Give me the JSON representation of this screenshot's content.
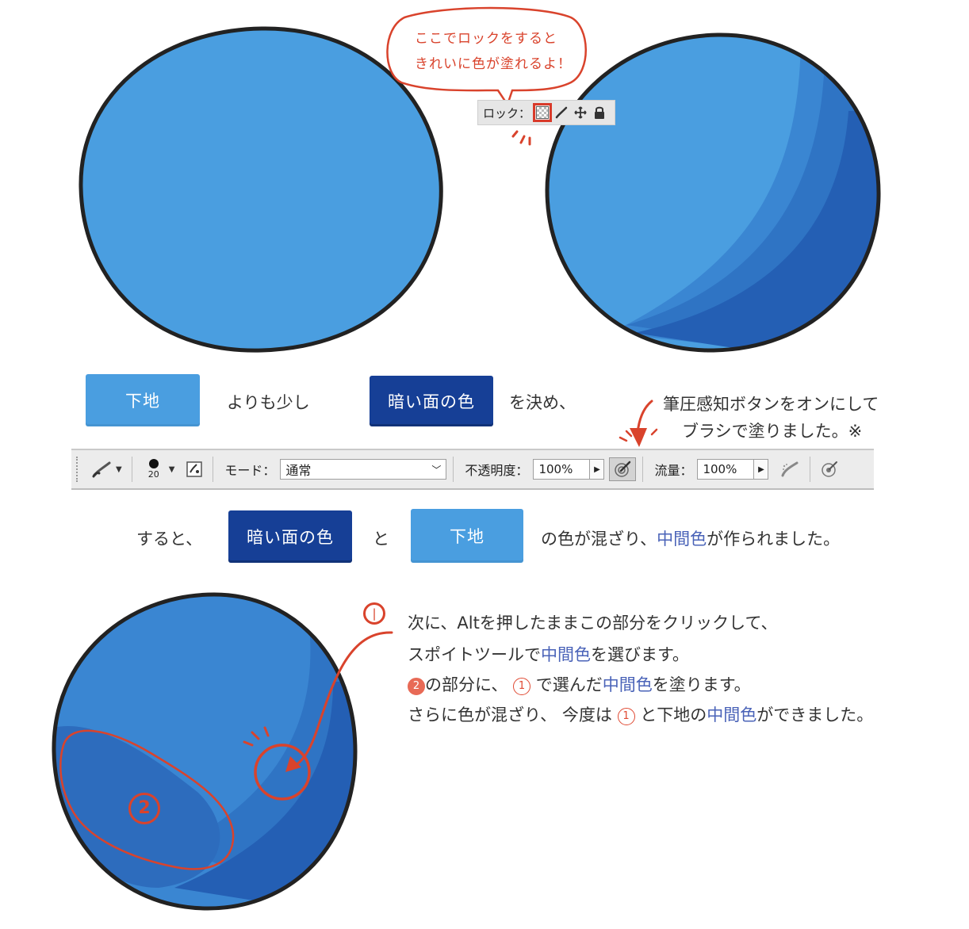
{
  "bubble": {
    "line1": "ここでロックをすると",
    "line2": "きれいに色が塗れるよ！"
  },
  "lockbar": {
    "label": "ロック："
  },
  "row1": {
    "chip_base": "下地",
    "text_a": "よりも少し",
    "chip_dark": "暗い面の色",
    "text_b": "を決め、"
  },
  "pressure_note": {
    "line1": "筆圧感知ボタンをオンにして",
    "line2": "ブラシで塗りました。※"
  },
  "toolbar": {
    "brush_size": "20",
    "mode_label": "モード：",
    "mode_value": "通常",
    "opacity_label": "不透明度：",
    "opacity_value": "100%",
    "flow_label": "流量：",
    "flow_value": "100%"
  },
  "row2": {
    "text_a": "すると、",
    "chip_dark": "暗い面の色",
    "text_b": "と",
    "chip_base": "下地",
    "text_c": "の色が混ざり、",
    "highlight": "中間色",
    "text_d": "が作られました。"
  },
  "steps": {
    "marker1": "①",
    "marker2": "②",
    "line1": "次に、Altを押したままこの部分をクリックして、",
    "line2_a": "スポイトツールで",
    "line2_hl": "中間色",
    "line2_b": "を選びます。",
    "line3_num": "②",
    "line3_a": "の部分に、",
    "line3_num2": "①",
    "line3_b": "で選んだ",
    "line3_hl": "中間色",
    "line3_c": "を塗ります。",
    "line4_a": "さらに色が混ざり、 今度は",
    "line4_num": "①",
    "line4_b": "と下地の",
    "line4_hl": "中間色",
    "line4_c": "ができました。"
  },
  "colors": {
    "base_blue": "#4a9ee0",
    "dark_blue": "#163f96",
    "mid_blue": "#2f74c4",
    "annotation_red": "#d9432c",
    "highlight_text": "#4a63b8"
  }
}
